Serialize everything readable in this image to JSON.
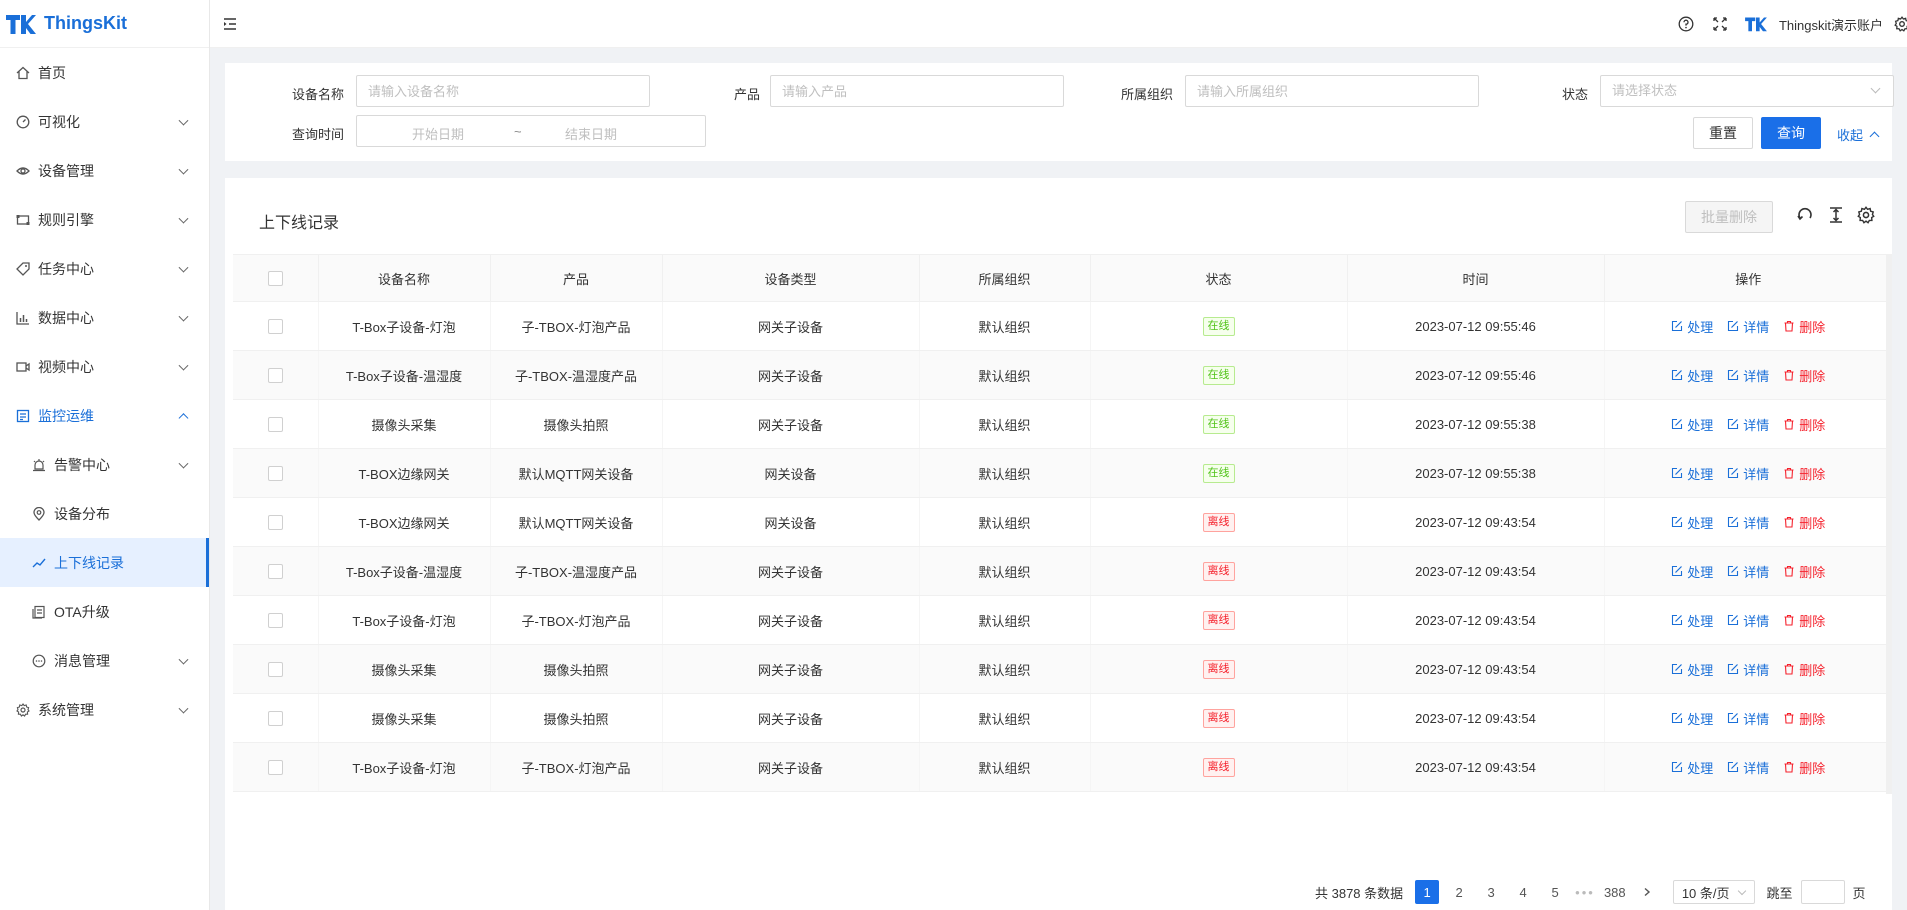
{
  "app": {
    "name": "ThingsKit"
  },
  "sidebar": {
    "items": [
      {
        "label": "首页",
        "icon": "home-icon"
      },
      {
        "label": "可视化",
        "icon": "dashboard-icon"
      },
      {
        "label": "设备管理",
        "icon": "eye-icon"
      },
      {
        "label": "规则引擎",
        "icon": "rule-icon"
      },
      {
        "label": "任务中心",
        "icon": "tag-icon"
      },
      {
        "label": "数据中心",
        "icon": "bar-chart-icon"
      },
      {
        "label": "视频中心",
        "icon": "video-icon"
      },
      {
        "label": "监控运维",
        "icon": "monitor-icon"
      },
      {
        "label": "告警中心",
        "icon": "alarm-icon"
      },
      {
        "label": "设备分布",
        "icon": "location-icon"
      },
      {
        "label": "上下线记录",
        "icon": "line-chart-icon"
      },
      {
        "label": "OTA升级",
        "icon": "ota-icon"
      },
      {
        "label": "消息管理",
        "icon": "message-icon"
      },
      {
        "label": "系统管理",
        "icon": "settings-icon"
      }
    ]
  },
  "header": {
    "account": "Thingskit演示账户"
  },
  "search": {
    "device_name_label": "设备名称",
    "device_name_placeholder": "请输入设备名称",
    "product_label": "产品",
    "product_placeholder": "请输入产品",
    "org_label": "所属组织",
    "org_placeholder": "请输入所属组织",
    "status_label": "状态",
    "status_placeholder": "请选择状态",
    "time_label": "查询时间",
    "start_placeholder": "开始日期",
    "range_separator": "~",
    "end_placeholder": "结束日期",
    "reset_label": "重置",
    "query_label": "查询",
    "collapse_label": "收起"
  },
  "table": {
    "title": "上下线记录",
    "batch_delete_label": "批量删除",
    "columns": [
      "设备名称",
      "产品",
      "设备类型",
      "所属组织",
      "状态",
      "时间",
      "操作"
    ],
    "actions": {
      "handle": "处理",
      "detail": "详情",
      "delete": "删除"
    },
    "status_colors": {
      "online": "#52c41a",
      "offline": "#f5222d"
    },
    "rows": [
      {
        "name": "T-Box子设备-灯泡",
        "product": "子-TBOX-灯泡产品",
        "type": "网关子设备",
        "org": "默认组织",
        "status": "在线",
        "status_kind": "on",
        "time": "2023-07-12 09:55:46"
      },
      {
        "name": "T-Box子设备-温湿度",
        "product": "子-TBOX-温湿度产品",
        "type": "网关子设备",
        "org": "默认组织",
        "status": "在线",
        "status_kind": "on",
        "time": "2023-07-12 09:55:46"
      },
      {
        "name": "摄像头采集",
        "product": "摄像头拍照",
        "type": "网关子设备",
        "org": "默认组织",
        "status": "在线",
        "status_kind": "on",
        "time": "2023-07-12 09:55:38"
      },
      {
        "name": "T-BOX边缘网关",
        "product": "默认MQTT网关设备",
        "type": "网关设备",
        "org": "默认组织",
        "status": "在线",
        "status_kind": "on",
        "time": "2023-07-12 09:55:38"
      },
      {
        "name": "T-BOX边缘网关",
        "product": "默认MQTT网关设备",
        "type": "网关设备",
        "org": "默认组织",
        "status": "离线",
        "status_kind": "off",
        "time": "2023-07-12 09:43:54"
      },
      {
        "name": "T-Box子设备-温湿度",
        "product": "子-TBOX-温湿度产品",
        "type": "网关子设备",
        "org": "默认组织",
        "status": "离线",
        "status_kind": "off",
        "time": "2023-07-12 09:43:54"
      },
      {
        "name": "T-Box子设备-灯泡",
        "product": "子-TBOX-灯泡产品",
        "type": "网关子设备",
        "org": "默认组织",
        "status": "离线",
        "status_kind": "off",
        "time": "2023-07-12 09:43:54"
      },
      {
        "name": "摄像头采集",
        "product": "摄像头拍照",
        "type": "网关子设备",
        "org": "默认组织",
        "status": "离线",
        "status_kind": "off",
        "time": "2023-07-12 09:43:54"
      },
      {
        "name": "摄像头采集",
        "product": "摄像头拍照",
        "type": "网关子设备",
        "org": "默认组织",
        "status": "离线",
        "status_kind": "off",
        "time": "2023-07-12 09:43:54"
      },
      {
        "name": "T-Box子设备-灯泡",
        "product": "子-TBOX-灯泡产品",
        "type": "网关子设备",
        "org": "默认组织",
        "status": "离线",
        "status_kind": "off",
        "time": "2023-07-12 09:43:54"
      }
    ]
  },
  "pagination": {
    "total_text": "共 3878 条数据",
    "pages": [
      "1",
      "2",
      "3",
      "4",
      "5"
    ],
    "ellipsis": "•••",
    "last_page": "388",
    "page_size": "10 条/页",
    "jump_label": "跳至",
    "page_unit": "页"
  },
  "colors": {
    "primary": "#1a6fe8",
    "brand": "#1a6fd8"
  }
}
